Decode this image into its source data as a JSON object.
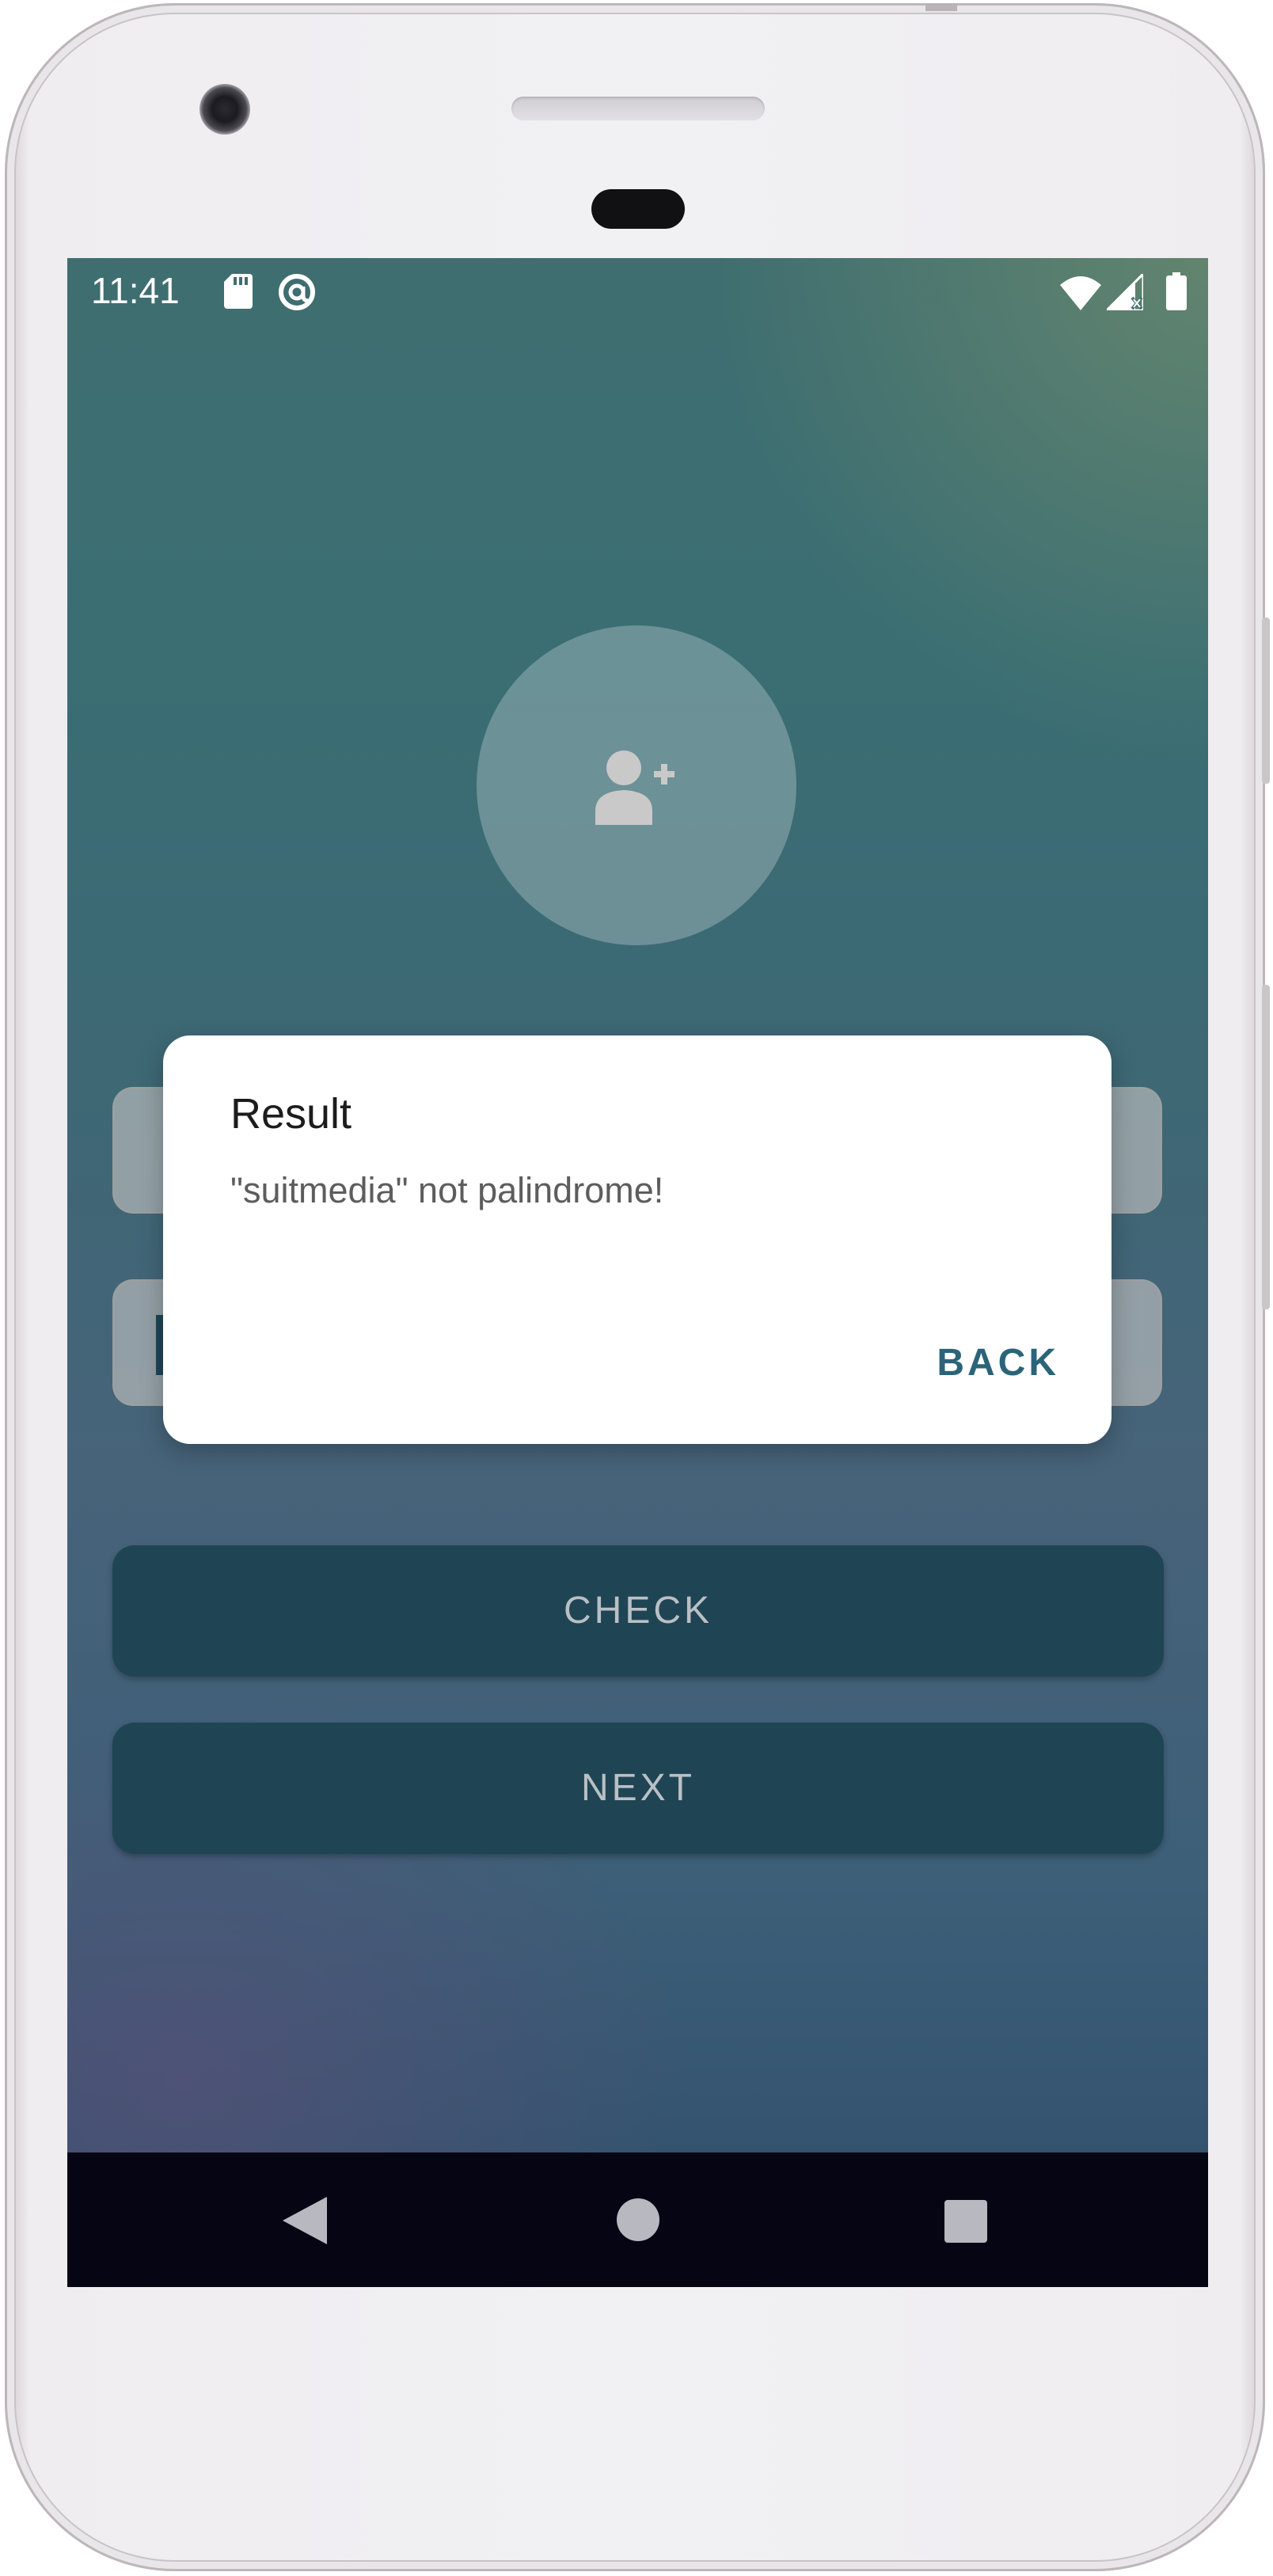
{
  "status_bar": {
    "time": "11:41",
    "icons": [
      "sd-card-icon",
      "at-sign-icon",
      "wifi-icon",
      "cell-signal-icon",
      "battery-icon"
    ]
  },
  "avatar": {
    "icon": "add-user-icon"
  },
  "inputs": {
    "name": {
      "value": ""
    },
    "palindrome": {
      "value": ""
    }
  },
  "buttons": {
    "check": "CHECK",
    "next": "NEXT"
  },
  "dialog": {
    "title": "Result",
    "message": "\"suitmedia\" not palindrome!",
    "back": "BACK"
  },
  "nav_bar": {
    "icons": [
      "nav-back-icon",
      "nav-home-icon",
      "nav-recents-icon"
    ]
  },
  "colors": {
    "button_bg": "#1f4555",
    "dialog_action": "#2b6479",
    "nav_bg": "#050514"
  }
}
